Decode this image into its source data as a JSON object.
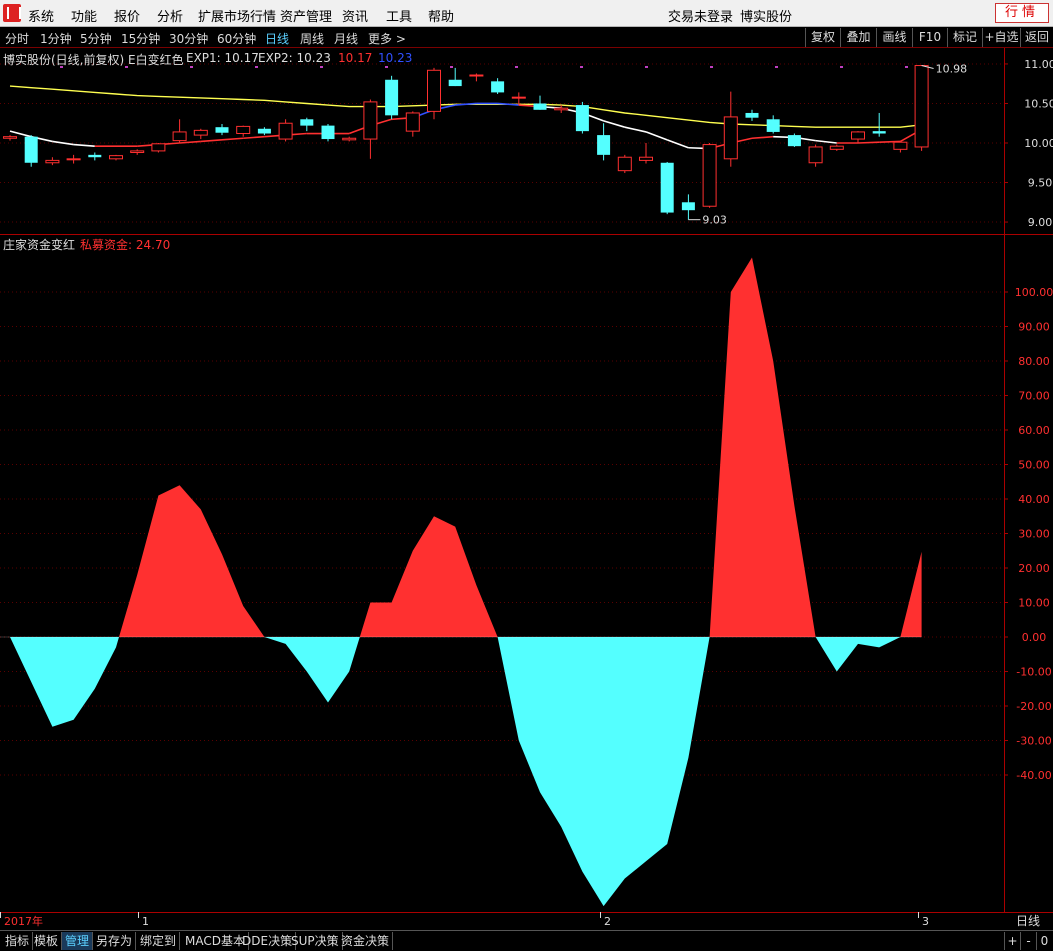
{
  "menu": {
    "items": [
      "系统",
      "功能",
      "报价",
      "分析",
      "扩展市场行情",
      "资产管理",
      "资讯",
      "工具",
      "帮助"
    ],
    "login_status": "交易未登录",
    "stock_name": "博实股份",
    "quote_button": "行情"
  },
  "periods": {
    "items": [
      "分时",
      "1分钟",
      "5分钟",
      "15分钟",
      "30分钟",
      "60分钟",
      "日线",
      "周线",
      "月线",
      "更多 >"
    ],
    "active": "日线",
    "right_buttons": [
      "复权",
      "叠加",
      "画线",
      "F10",
      "标记",
      "+自选",
      "返回"
    ]
  },
  "price_panel": {
    "title": "博实股份(日线,前复权) E白变红色",
    "exp1_label": "EXP1: 10.17",
    "exp2_label": "EXP2: 10.23",
    "val_red": "10.17",
    "val_blue": "10.23",
    "high_marker": "10.98",
    "low_marker": "9.03",
    "y_ticks": [
      "11.00",
      "10.50",
      "10.00",
      "9.50",
      "9.00"
    ]
  },
  "indicator_panel": {
    "title": "庄家资金变红",
    "series_label": "私募资金: 24.70",
    "y_ticks": [
      "100.00",
      "90.00",
      "80.00",
      "70.00",
      "60.00",
      "50.00",
      "40.00",
      "30.00",
      "20.00",
      "10.00",
      "0.00",
      "-10.00",
      "-20.00",
      "-30.00",
      "-40.00"
    ]
  },
  "time_axis": {
    "labels": [
      "2017年",
      "1",
      "2",
      "3"
    ],
    "period_label": "日线"
  },
  "bottom_tabs": {
    "items": [
      "指标",
      "模板",
      "管理",
      "另存为",
      "绑定到",
      "MACD基本",
      "DDE决策",
      "SUP决策",
      "资金决策"
    ],
    "active": "管理",
    "nav": [
      "+",
      "-",
      "0"
    ]
  },
  "colors": {
    "up": "#ff3030",
    "down": "#54ffff",
    "ma_yellow": "#ffff50",
    "ma_white": "#ffffff",
    "axis_red": "#aa0000",
    "blue_label": "#3050ff"
  },
  "chart_data": [
    {
      "type": "candlestick",
      "title": "博实股份(日线,前复权)",
      "ylim": [
        8.95,
        11.05
      ],
      "candles": [
        {
          "o": 10.06,
          "h": 10.1,
          "l": 10.03,
          "c": 10.08
        },
        {
          "o": 10.08,
          "h": 10.1,
          "l": 9.7,
          "c": 9.75
        },
        {
          "o": 9.75,
          "h": 9.82,
          "l": 9.72,
          "c": 9.78
        },
        {
          "o": 9.8,
          "h": 9.85,
          "l": 9.74,
          "c": 9.8
        },
        {
          "o": 9.85,
          "h": 9.88,
          "l": 9.78,
          "c": 9.82
        },
        {
          "o": 9.8,
          "h": 9.85,
          "l": 9.78,
          "c": 9.84
        },
        {
          "o": 9.88,
          "h": 9.92,
          "l": 9.85,
          "c": 9.9
        },
        {
          "o": 9.9,
          "h": 10.0,
          "l": 9.88,
          "c": 9.99
        },
        {
          "o": 10.03,
          "h": 10.3,
          "l": 10.0,
          "c": 10.14
        },
        {
          "o": 10.1,
          "h": 10.18,
          "l": 10.05,
          "c": 10.16
        },
        {
          "o": 10.2,
          "h": 10.24,
          "l": 10.1,
          "c": 10.13
        },
        {
          "o": 10.12,
          "h": 10.22,
          "l": 10.08,
          "c": 10.21
        },
        {
          "o": 10.18,
          "h": 10.2,
          "l": 10.1,
          "c": 10.12
        },
        {
          "o": 10.05,
          "h": 10.3,
          "l": 10.02,
          "c": 10.25
        },
        {
          "o": 10.3,
          "h": 10.32,
          "l": 10.15,
          "c": 10.22
        },
        {
          "o": 10.22,
          "h": 10.24,
          "l": 10.02,
          "c": 10.05
        },
        {
          "o": 10.04,
          "h": 10.08,
          "l": 10.02,
          "c": 10.06
        },
        {
          "o": 10.05,
          "h": 10.55,
          "l": 9.8,
          "c": 10.52
        },
        {
          "o": 10.8,
          "h": 10.85,
          "l": 10.3,
          "c": 10.35
        },
        {
          "o": 10.15,
          "h": 10.4,
          "l": 10.08,
          "c": 10.38
        },
        {
          "o": 10.4,
          "h": 10.95,
          "l": 10.3,
          "c": 10.92
        },
        {
          "o": 10.8,
          "h": 10.95,
          "l": 10.72,
          "c": 10.72
        },
        {
          "o": 10.85,
          "h": 10.88,
          "l": 10.78,
          "c": 10.86
        },
        {
          "o": 10.78,
          "h": 10.82,
          "l": 10.62,
          "c": 10.64
        },
        {
          "o": 10.58,
          "h": 10.64,
          "l": 10.48,
          "c": 10.58
        },
        {
          "o": 10.5,
          "h": 10.6,
          "l": 10.42,
          "c": 10.42
        },
        {
          "o": 10.42,
          "h": 10.48,
          "l": 10.38,
          "c": 10.44
        },
        {
          "o": 10.48,
          "h": 10.52,
          "l": 10.12,
          "c": 10.15
        },
        {
          "o": 10.1,
          "h": 10.25,
          "l": 9.78,
          "c": 9.85
        },
        {
          "o": 9.65,
          "h": 9.85,
          "l": 9.62,
          "c": 9.82
        },
        {
          "o": 9.78,
          "h": 10.0,
          "l": 9.74,
          "c": 9.82
        },
        {
          "o": 9.75,
          "h": 9.76,
          "l": 9.1,
          "c": 9.12
        },
        {
          "o": 9.25,
          "h": 9.35,
          "l": 9.03,
          "c": 9.15
        },
        {
          "o": 9.2,
          "h": 10.0,
          "l": 9.18,
          "c": 9.98
        },
        {
          "o": 9.8,
          "h": 10.65,
          "l": 9.7,
          "c": 10.33
        },
        {
          "o": 10.38,
          "h": 10.42,
          "l": 10.28,
          "c": 10.32
        },
        {
          "o": 10.3,
          "h": 10.35,
          "l": 10.12,
          "c": 10.14
        },
        {
          "o": 10.1,
          "h": 10.12,
          "l": 9.95,
          "c": 9.96
        },
        {
          "o": 9.75,
          "h": 9.98,
          "l": 9.7,
          "c": 9.95
        },
        {
          "o": 9.92,
          "h": 9.98,
          "l": 9.9,
          "c": 9.96
        },
        {
          "o": 10.05,
          "h": 10.15,
          "l": 10.0,
          "c": 10.14
        },
        {
          "o": 10.15,
          "h": 10.38,
          "l": 10.08,
          "c": 10.12
        },
        {
          "o": 9.92,
          "h": 10.02,
          "l": 9.88,
          "c": 10.01
        },
        {
          "o": 9.95,
          "h": 10.98,
          "l": 9.9,
          "c": 10.98
        }
      ],
      "series": [
        {
          "name": "EXP1",
          "color": "yellow",
          "values": [
            10.72,
            10.7,
            10.68,
            10.66,
            10.64,
            10.62,
            10.6,
            10.59,
            10.58,
            10.57,
            10.56,
            10.55,
            10.54,
            10.52,
            10.5,
            10.48,
            10.46,
            10.46,
            10.46,
            10.47,
            10.48,
            10.49,
            10.49,
            10.49,
            10.49,
            10.49,
            10.48,
            10.46,
            10.42,
            10.38,
            10.35,
            10.32,
            10.29,
            10.26,
            10.24,
            10.23,
            10.22,
            10.21,
            10.2,
            10.2,
            10.2,
            10.2,
            10.2,
            10.23
          ]
        },
        {
          "name": "EXP2",
          "color": "white-red",
          "values": [
            10.15,
            10.08,
            10.02,
            9.98,
            9.96,
            9.96,
            9.96,
            9.98,
            10.0,
            10.02,
            10.04,
            10.06,
            10.08,
            10.1,
            10.12,
            10.12,
            10.12,
            10.22,
            10.3,
            10.32,
            10.42,
            10.48,
            10.5,
            10.5,
            10.48,
            10.46,
            10.44,
            10.38,
            10.28,
            10.2,
            10.14,
            10.04,
            9.94,
            9.93,
            10.0,
            10.06,
            10.08,
            10.07,
            10.03,
            10.0,
            10.0,
            10.01,
            10.02,
            10.17
          ]
        }
      ],
      "low_label": "9.03",
      "high_label": "10.98"
    },
    {
      "type": "area",
      "title": "庄家资金变红",
      "series_name": "私募资金",
      "ylim": [
        -45,
        110
      ],
      "values": [
        0,
        -13,
        -26,
        -24,
        -15,
        -3,
        18,
        41,
        44,
        37,
        24,
        9,
        0,
        -2,
        -10,
        -19,
        -10,
        10,
        10,
        25,
        35,
        32,
        15,
        0,
        -30,
        -45,
        -55,
        -68,
        -78,
        -70,
        -65,
        -60,
        -35,
        0,
        100,
        110,
        80,
        38,
        0,
        -10,
        -2,
        -3,
        0,
        24.7
      ]
    }
  ]
}
